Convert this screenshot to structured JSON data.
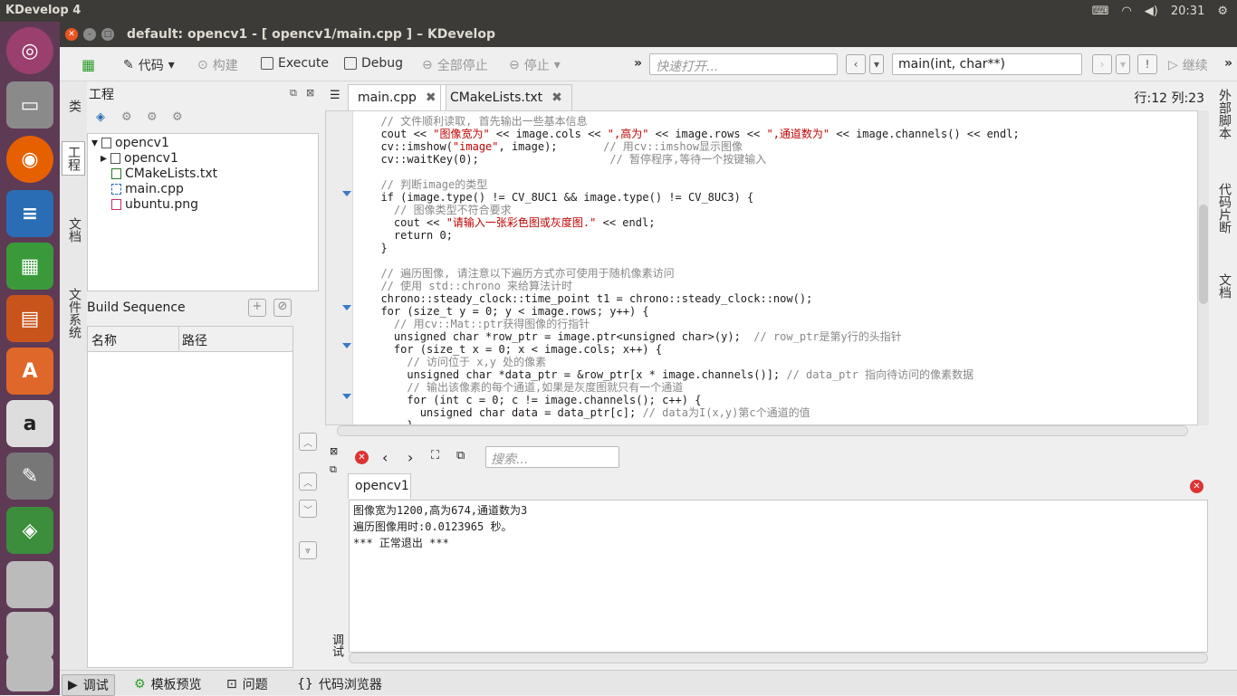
{
  "topbar": {
    "app_name": "KDevelop 4",
    "time": "20:31",
    "keyboard_icon": "keyboard-icon",
    "wifi_icon": "wifi-icon",
    "volume_icon": "volume-icon",
    "settings_icon": "gear-icon"
  },
  "launcher": {
    "items": [
      "ubuntu-dash",
      "files",
      "firefox",
      "writer",
      "calc",
      "impress",
      "software-center",
      "amazon",
      "system-settings",
      "kdevelop",
      "drive",
      "drive",
      "drive"
    ]
  },
  "window": {
    "title": "default:  opencv1 - [ opencv1/main.cpp ] – KDevelop"
  },
  "toolbar": {
    "code": "代码",
    "build": "构建",
    "execute": "Execute",
    "debug": "Debug",
    "stop_all": "全部停止",
    "stop": "停止",
    "quickopen_placeholder": "快速打开...",
    "context": "main(int, char**)",
    "continue": "继续"
  },
  "left_tabs": {
    "classes": "类",
    "project": "工程",
    "documents": "文档",
    "filesystem": "文件系统"
  },
  "project_panel": {
    "title": "工程",
    "tree": [
      {
        "label": "opencv1"
      },
      {
        "label": "opencv1"
      },
      {
        "label": "CMakeLists.txt"
      },
      {
        "label": "main.cpp"
      },
      {
        "label": "ubuntu.png"
      }
    ],
    "build_sequence": "Build Sequence",
    "columns": [
      "名称",
      "路径"
    ]
  },
  "editor": {
    "tabs": [
      {
        "label": "main.cpp"
      },
      {
        "label": "CMakeLists.txt"
      }
    ],
    "position": "行:12 列:23",
    "lines": [
      "  // 文件顺利读取, 首先输出一些基本信息",
      "  cout << \"图像宽为\" << image.cols << \",高为\" << image.rows << \",通道数为\" << image.channels() << endl;",
      "  cv::imshow(\"image\", image);       // 用cv::imshow显示图像",
      "  cv::waitKey(0);                    // 暂停程序,等待一个按键输入",
      "",
      "  // 判断image的类型",
      "  if (image.type() != CV_8UC1 && image.type() != CV_8UC3) {",
      "    // 图像类型不符合要求",
      "    cout << \"请输入一张彩色图或灰度图.\" << endl;",
      "    return 0;",
      "  }",
      "",
      "  // 遍历图像, 请注意以下遍历方式亦可使用于随机像素访问",
      "  // 使用 std::chrono 来给算法计时",
      "  chrono::steady_clock::time_point t1 = chrono::steady_clock::now();",
      "  for (size_t y = 0; y < image.rows; y++) {",
      "    // 用cv::Mat::ptr获得图像的行指针",
      "    unsigned char *row_ptr = image.ptr<unsigned char>(y);  // row_ptr是第y行的头指针",
      "    for (size_t x = 0; x < image.cols; x++) {",
      "      // 访问位于 x,y 处的像素",
      "      unsigned char *data_ptr = &row_ptr[x * image.channels()]; // data_ptr 指向待访问的像素数据",
      "      // 输出该像素的每个通道,如果是灰度图就只有一个通道",
      "      for (int c = 0; c != image.channels(); c++) {",
      "        unsigned char data = data_ptr[c]; // data为I(x,y)第c个通道的值",
      "      }"
    ]
  },
  "right_tabs": {
    "external_scripts": "外部脚本",
    "snippets": "代码片断",
    "docs": "文档"
  },
  "output_dock": {
    "search_placeholder": "搜索...",
    "tab": "opencv1",
    "lines": [
      "图像宽为1200,高为674,通道数为3",
      "遍历图像用时:0.0123965 秒。",
      "*** 正常退出 ***"
    ],
    "side_label": "调试"
  },
  "bottom_tabs": [
    {
      "label": "调试"
    },
    {
      "label": "模板预览"
    },
    {
      "label": "问题"
    },
    {
      "label": "代码浏览器"
    }
  ],
  "colors": {
    "launcher": "#5e3a55",
    "topbar": "#3c3b37",
    "keyword": "#1f1c1b",
    "string": "#bf0303",
    "comment": "#898887",
    "type": "#0057ae"
  }
}
